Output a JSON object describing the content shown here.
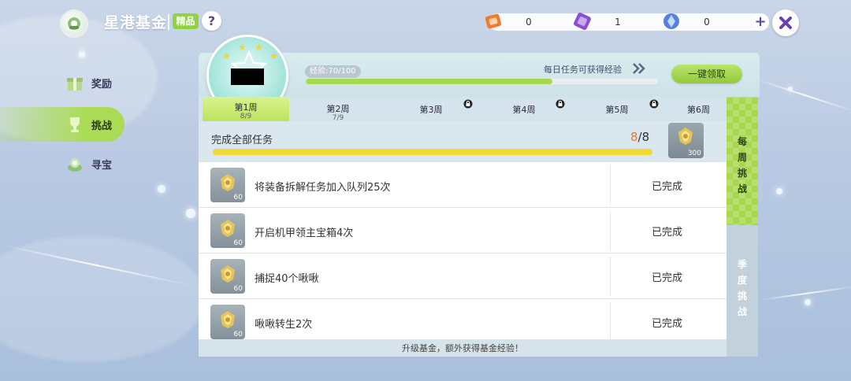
{
  "header": {
    "title": "星港基金",
    "badge": "精品",
    "help": "?"
  },
  "currencies": [
    {
      "icon": "orange-ticket-icon",
      "value": "0"
    },
    {
      "icon": "purple-card-icon",
      "value": "1"
    },
    {
      "icon": "blue-crystal-icon",
      "value": "0"
    }
  ],
  "sidebar": {
    "items": [
      {
        "label": "奖励",
        "icon": "gift-icon",
        "active": false
      },
      {
        "label": "挑战",
        "icon": "trophy-icon",
        "active": true
      },
      {
        "label": "寻宝",
        "icon": "treasure-icon",
        "active": false
      }
    ]
  },
  "progress": {
    "exp_label": "经验:70/100",
    "exp_fraction": 0.7,
    "daily_tip": "每日任务可获得经验",
    "claim_all": "一键领取"
  },
  "weeks": [
    {
      "name": "第1周",
      "progress": "8/9",
      "active": true,
      "locked": false
    },
    {
      "name": "第2周",
      "progress": "7/9",
      "active": false,
      "locked": false
    },
    {
      "name": "第3周",
      "progress": "",
      "active": false,
      "locked": true
    },
    {
      "name": "第4周",
      "progress": "",
      "active": false,
      "locked": true
    },
    {
      "name": "第5周",
      "progress": "",
      "active": false,
      "locked": true
    },
    {
      "name": "第6周",
      "progress": "",
      "active": false,
      "locked": false
    }
  ],
  "summary": {
    "title": "完成全部任务",
    "done": "8",
    "total": "/8",
    "fraction": 1.0,
    "reward_count": "300"
  },
  "tasks": [
    {
      "desc": "将装备拆解任务加入队列25次",
      "reward": "60",
      "status": "已完成"
    },
    {
      "desc": "开启机甲领主宝箱4次",
      "reward": "60",
      "status": "已完成"
    },
    {
      "desc": "捕捉40个啾啾",
      "reward": "60",
      "status": "已完成"
    },
    {
      "desc": "啾啾转生2次",
      "reward": "60",
      "status": "已完成"
    }
  ],
  "footer": "升级基金，额外获得基金经验！",
  "side_tabs": {
    "weekly": [
      "每",
      "周",
      "挑",
      "战"
    ],
    "season": [
      "季",
      "度",
      "挑",
      "战"
    ]
  }
}
